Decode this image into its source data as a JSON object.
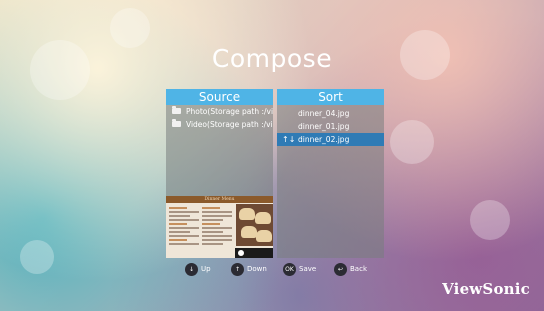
{
  "title": "Compose",
  "source_panel": {
    "header": "Source",
    "items": [
      {
        "label": "Photo(Storage path :/vie"
      },
      {
        "label": "Video(Storage path :/vie"
      }
    ]
  },
  "sort_panel": {
    "header": "Sort",
    "items": [
      {
        "label": "dinner_04.jpg",
        "selected": false
      },
      {
        "label": "dinner_01.jpg",
        "selected": false
      },
      {
        "label": "dinner_02.jpg",
        "selected": true,
        "marker": "↑↓"
      }
    ]
  },
  "preview": {
    "menu_header": "Dinner Menu"
  },
  "controls": [
    {
      "key": "↓",
      "label": "Up"
    },
    {
      "key": "↑",
      "label": "Down"
    },
    {
      "key": "OK",
      "label": "Save"
    },
    {
      "key": "↩",
      "label": "Back"
    }
  ],
  "brand": "ViewSonic",
  "colors": {
    "header_blue": "#4fb4e6",
    "selection_blue": "#2f7bb5"
  }
}
